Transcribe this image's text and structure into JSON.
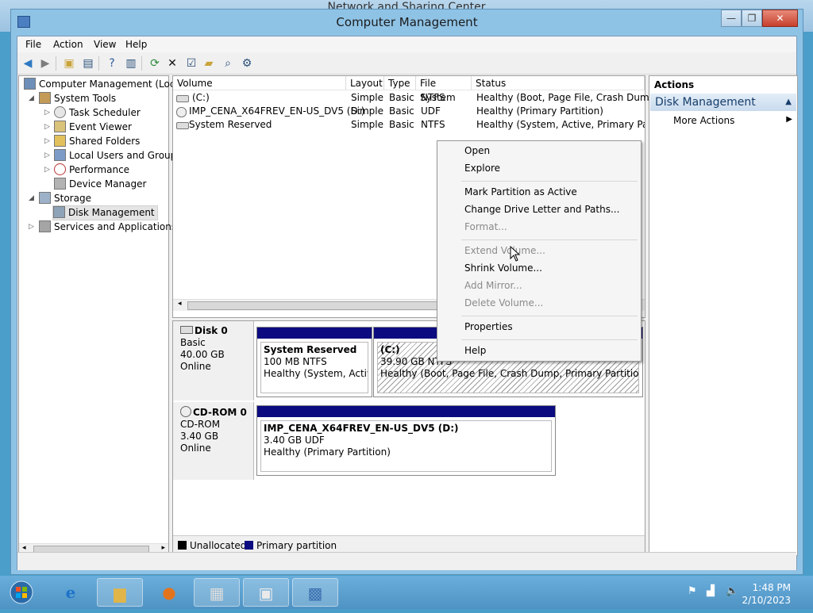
{
  "background_window": {
    "title": "Network and Sharing Center"
  },
  "window": {
    "title": "Computer Management",
    "minimize": "—",
    "maximize": "❐",
    "close": "✕"
  },
  "menu": [
    "File",
    "Action",
    "View",
    "Help"
  ],
  "tree": {
    "root": "Computer Management (Local",
    "system_tools": "System Tools",
    "task_scheduler": "Task Scheduler",
    "event_viewer": "Event Viewer",
    "shared_folders": "Shared Folders",
    "local_users": "Local Users and Groups",
    "performance": "Performance",
    "device_manager": "Device Manager",
    "storage": "Storage",
    "disk_management": "Disk Management",
    "services": "Services and Applications"
  },
  "volume_table": {
    "headers": [
      "Volume",
      "Layout",
      "Type",
      "File System",
      "Status"
    ],
    "rows": [
      {
        "volume": "(C:)",
        "layout": "Simple",
        "type": "Basic",
        "fs": "NTFS",
        "status": "Healthy (Boot, Page File, Crash Dump, P"
      },
      {
        "volume": "IMP_CENA_X64FREV_EN-US_DV5 (D:)",
        "layout": "Simple",
        "type": "Basic",
        "fs": "UDF",
        "status": "Healthy (Primary Partition)"
      },
      {
        "volume": "System Reserved",
        "layout": "Simple",
        "type": "Basic",
        "fs": "NTFS",
        "status": "Healthy (System, Active, Primary Partitio"
      }
    ]
  },
  "disks": {
    "disk0": {
      "name": "Disk 0",
      "type": "Basic",
      "size": "40.00 GB",
      "state": "Online",
      "p1": {
        "name": "System Reserved",
        "size": "100 MB NTFS",
        "status": "Healthy (System, Active,"
      },
      "p2": {
        "name": "(C:)",
        "size": "39.90 GB NTFS",
        "status": "Healthy (Boot, Page File, Crash Dump, Primary Partition)"
      }
    },
    "cdrom0": {
      "name": "CD-ROM 0",
      "type": "CD-ROM",
      "size": "3.40 GB",
      "state": "Online",
      "p1": {
        "name": "IMP_CENA_X64FREV_EN-US_DV5  (D:)",
        "size": "3.40 GB UDF",
        "status": "Healthy (Primary Partition)"
      }
    }
  },
  "legend": {
    "unallocated": "Unallocated",
    "primary": "Primary partition"
  },
  "actions": {
    "title": "Actions",
    "section": "Disk Management",
    "more": "More Actions"
  },
  "context_menu": [
    {
      "label": "Open",
      "enabled": true
    },
    {
      "label": "Explore",
      "enabled": true
    },
    {
      "label": "Mark Partition as Active",
      "enabled": true
    },
    {
      "label": "Change Drive Letter and Paths...",
      "enabled": true
    },
    {
      "label": "Format...",
      "enabled": false
    },
    {
      "label": "Extend Volume...",
      "enabled": false
    },
    {
      "label": "Shrink Volume...",
      "enabled": true
    },
    {
      "label": "Add Mirror...",
      "enabled": false
    },
    {
      "label": "Delete Volume...",
      "enabled": false
    },
    {
      "label": "Properties",
      "enabled": true
    },
    {
      "label": "Help",
      "enabled": true
    }
  ],
  "colors": {
    "primary_partition": "#0c0b7f",
    "unallocated": "#000000"
  },
  "taskbar": {
    "items": [
      "start-icon",
      "ie-icon",
      "file-explorer-icon",
      "firefox-icon",
      "control-panel-icon",
      "disk-management-icon",
      "computer-management-icon"
    ],
    "time": "1:48 PM",
    "date": "2/10/2023"
  }
}
